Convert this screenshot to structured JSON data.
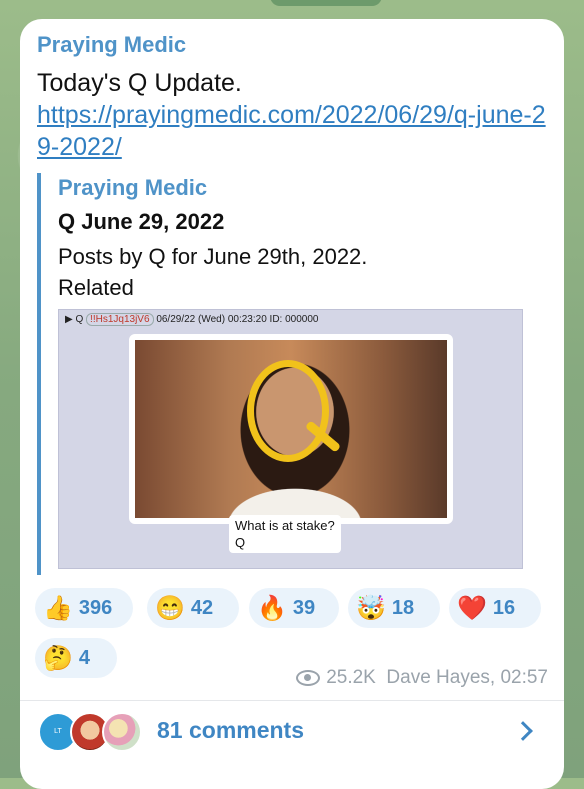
{
  "message": {
    "channel_name": "Praying Medic",
    "text": "Today's Q Update.",
    "link": "https://prayingmedic.com/2022/06/29/q-june-29-2022/"
  },
  "preview": {
    "site_name": "Praying Medic",
    "title": "Q June 29, 2022",
    "description": "Posts by Q for June 29th, 2022.",
    "related": "Related",
    "image": {
      "post_header": {
        "arrow": "▶",
        "name": "Q",
        "tripcode": "!!Hs1Jq13jV6",
        "datetime": "06/29/22 (Wed) 00:23:20",
        "id": "ID: 000000"
      },
      "caption_line1": "What is at stake?",
      "caption_line2": "Q"
    }
  },
  "reactions": [
    {
      "emoji": "👍",
      "count": "396"
    },
    {
      "emoji": "😁",
      "count": "42"
    },
    {
      "emoji": "🔥",
      "count": "39"
    },
    {
      "emoji": "🤯",
      "count": "18"
    },
    {
      "emoji": "❤️",
      "count": "16"
    },
    {
      "emoji": "🤔",
      "count": "4"
    }
  ],
  "meta": {
    "views": "25.2K",
    "author_time": "Dave Hayes, 02:57"
  },
  "comments": {
    "label": "81 comments",
    "avatar_initials": "LT"
  },
  "colors": {
    "accent": "#3f86c3",
    "name": "#4f93c8",
    "reaction_bg": "#eaf3fb"
  }
}
